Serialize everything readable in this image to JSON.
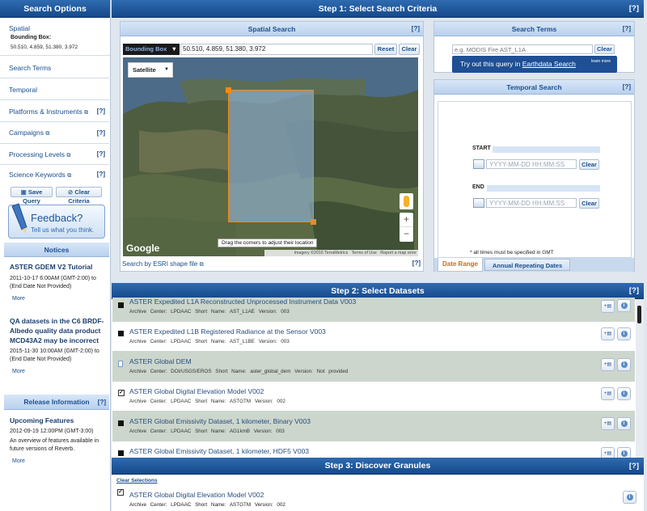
{
  "sidebar": {
    "title": "Search Options",
    "spatial": {
      "label": "Spatial",
      "bbox_label": "Bounding Box:",
      "bbox_value": "50.510, 4.859, 51.380, 3.972"
    },
    "items": [
      {
        "label": "Search Terms",
        "help": ""
      },
      {
        "label": "Temporal",
        "help": ""
      },
      {
        "label": "Platforms & Instruments",
        "help": "[?]"
      },
      {
        "label": "Campaigns",
        "help": "[?]"
      },
      {
        "label": "Processing Levels",
        "help": "[?]"
      },
      {
        "label": "Science Keywords",
        "help": "[?]"
      }
    ],
    "save_query": "Save Query",
    "clear_criteria": "Clear Criteria",
    "feedback_title": "Feedback?",
    "feedback_sub": "Tell us what you think.",
    "notices_title": "Notices",
    "notices": [
      {
        "title": "ASTER GDEM V2 Tutorial",
        "date": "2011-10-17 6:00AM (GMT-2:00) to (End Date Not Provided)",
        "more": "More"
      },
      {
        "title": "QA datasets in the C6 BRDF-Albedo quality data product MCD43A2 may be incorrect",
        "date": "2015-11-30 10:00AM (GMT-2:00) to (End Date Not Provided)",
        "more": "More"
      }
    ],
    "release_title": "Release Information",
    "release_help": "[?]",
    "release": {
      "title": "Upcoming Features",
      "date": "2012-09-19 12:00PM (GMT-3:00)",
      "desc": "An overview of features available in future versions of Reverb.",
      "more": "More"
    }
  },
  "step1": {
    "title": "Step 1: Select Search Criteria",
    "help": "[?]",
    "spatial": {
      "title": "Spatial Search",
      "help": "[?]",
      "mode": "Bounding Box",
      "coords": "50.510, 4.859, 51.380, 3.972",
      "reset": "Reset",
      "clear": "Clear",
      "map_type": "Satellite",
      "tooltip": "Drag the corners to adjust their location",
      "attribution": [
        "Imagery ©2016 TerraMetrics",
        "Terms of Use",
        "Report a map error"
      ],
      "google": "Google",
      "zoom_in": "+",
      "zoom_out": "−",
      "esri": "Search by ESRI shape file"
    },
    "terms": {
      "title": "Search Terms",
      "help": "[?]",
      "placeholder": "e.g. MODIS Fire AST_L1A",
      "clear": "Clear",
      "tip_prefix": "Try out this query in",
      "tip_link": "Earthdata Search",
      "learn_more": "learn more"
    },
    "temporal": {
      "title": "Temporal Search",
      "help": "[?]",
      "start_label": "START",
      "end_label": "END",
      "date_placeholder": "YYYY-MM-DD HH:MM:SS",
      "clear": "Clear",
      "note": "* all times must be specified in GMT",
      "tabs": [
        "Date Range",
        "Annual Repeating Dates"
      ]
    }
  },
  "step2": {
    "title": "Step 2: Select Datasets",
    "help": "[?]",
    "datasets": [
      {
        "title": "ASTER Expedited L1A Reconstructed Unprocessed Instrument Data V003",
        "meta": "Archive Center: LPDAAC   Short Name: AST_L1AE   Version: 003",
        "bg": "#ccd6cc"
      },
      {
        "title": "ASTER Expedited L1B Registered Radiance at the Sensor V003",
        "meta": "Archive Center: LPDAAC   Short Name: AST_L1BE   Version: 003",
        "bg": "#ffffff"
      },
      {
        "title": "ASTER Global DEM",
        "meta": "Archive Center: DOI/USGS/EROS   Short Name: aster_global_dem   Version: Not provided",
        "bg": "#ccd6cc"
      },
      {
        "title": "ASTER Global Digital Elevation Model V002",
        "meta": "Archive Center: LPDAAC   Short Name: ASTGTM   Version: 002",
        "bg": "#ffffff"
      },
      {
        "title": "ASTER Global Emissivity Dataset, 1 kilometer, Binary V003",
        "meta": "Archive Center: LPDAAC   Short Name: AG1kmB   Version: 003",
        "bg": "#ccd6cc"
      },
      {
        "title": "ASTER Global Emissivity Dataset, 1 kilometer, HDF5 V003",
        "meta": "",
        "bg": "#ffffff"
      }
    ]
  },
  "step3": {
    "title": "Step 3: Discover Granules",
    "help": "[?]",
    "clear_selections": "Clear Selections",
    "granule": {
      "title": "ASTER Global Digital Elevation Model V002",
      "meta": "Archive Center: LPDAAC   Short Name: ASTGTM   Version: 002"
    }
  }
}
